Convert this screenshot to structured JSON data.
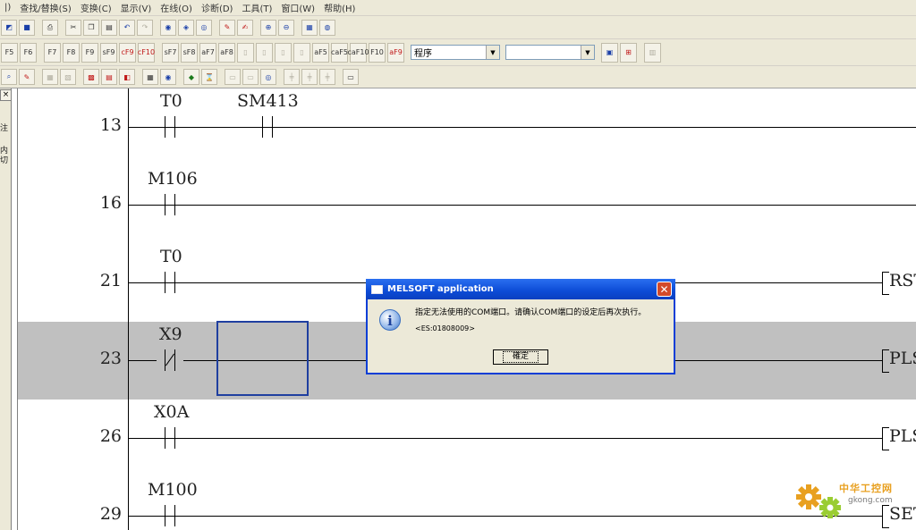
{
  "menu": [
    "查找/替换(S)",
    "变换(C)",
    "显示(V)",
    "在线(O)",
    "诊断(D)",
    "工具(T)",
    "窗口(W)",
    "帮助(H)"
  ],
  "toolbar1": {
    "icons": [
      "save-icon",
      "print-icon",
      "cut-icon",
      "copy-icon",
      "paste-icon",
      "undo-icon",
      "redo-icon",
      "find-device-icon",
      "find-instruction-icon",
      "replace-icon",
      "monitor-icon",
      "write-icon",
      "zoom-in-icon",
      "zoom-out-icon",
      "comment-icon",
      "device-memory-icon"
    ]
  },
  "toolbar2": {
    "keys": [
      "F5",
      "F6",
      "F7",
      "F8",
      "F9",
      "sF9",
      "cF9",
      "cF10",
      "sF7",
      "sF8",
      "aF7",
      "aF8",
      "aF5",
      "caF5",
      "caF10",
      "F10",
      "aF9"
    ],
    "program_select": "程序",
    "second_select": ""
  },
  "left_panel": {
    "text": "注\n内\n切"
  },
  "ladder": {
    "rungs": [
      {
        "step": "13",
        "contacts": [
          {
            "device": "T0",
            "type": "NO"
          },
          {
            "device": "SM413",
            "type": "NO"
          }
        ],
        "instruction": ""
      },
      {
        "step": "16",
        "contacts": [
          {
            "device": "M106",
            "type": "NO"
          }
        ],
        "instruction": ""
      },
      {
        "step": "21",
        "contacts": [
          {
            "device": "T0",
            "type": "NO"
          }
        ],
        "instruction": "RST"
      },
      {
        "step": "23",
        "contacts": [
          {
            "device": "X9",
            "type": "NC"
          }
        ],
        "instruction": "PLS"
      },
      {
        "step": "26",
        "contacts": [
          {
            "device": "X0A",
            "type": "NO"
          }
        ],
        "instruction": "PLS"
      },
      {
        "step": "29",
        "contacts": [
          {
            "device": "M100",
            "type": "NO"
          }
        ],
        "instruction": "SET"
      }
    ]
  },
  "dialog": {
    "title": "MELSOFT application",
    "message": "指定无法使用的COM端口。请确认COM端口的设定后再次执行。",
    "code": "<ES:01808009>",
    "ok_label": "確定"
  },
  "watermark": {
    "text": "中华工控网",
    "url": "gkong.com"
  },
  "colors": {
    "selected_rung": "#c0c0c0",
    "cursor": "#1f3fa0",
    "dialog_title": "#0c4bd6"
  }
}
